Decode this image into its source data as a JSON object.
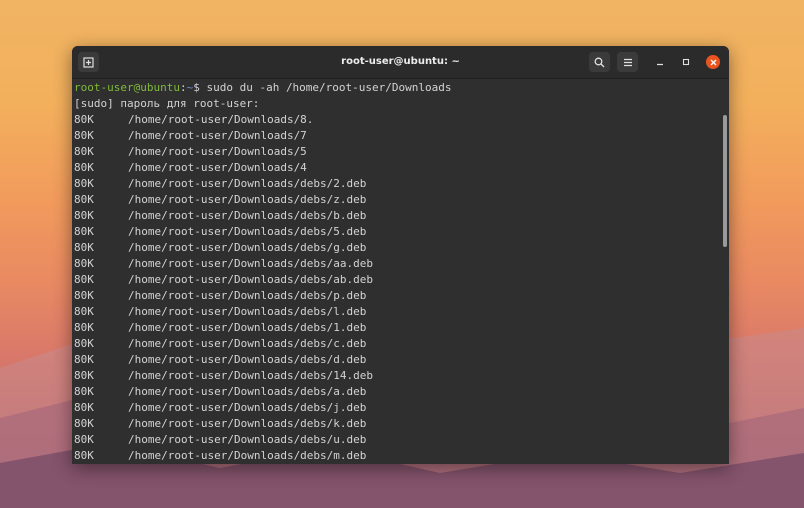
{
  "window": {
    "title": "root-user@ubuntu: ~"
  },
  "terminal": {
    "prompt_user": "root-user@ubuntu",
    "prompt_sep": ":",
    "prompt_path": "~",
    "prompt_symbol": "$",
    "command": "sudo du -ah /home/root-user/Downloads",
    "sudo_prompt": "[sudo] пароль для root-user:",
    "rows": [
      {
        "size": "80K",
        "path": "/home/root-user/Downloads/8."
      },
      {
        "size": "80K",
        "path": "/home/root-user/Downloads/7"
      },
      {
        "size": "80K",
        "path": "/home/root-user/Downloads/5"
      },
      {
        "size": "80K",
        "path": "/home/root-user/Downloads/4"
      },
      {
        "size": "80K",
        "path": "/home/root-user/Downloads/debs/2.deb"
      },
      {
        "size": "80K",
        "path": "/home/root-user/Downloads/debs/z.deb"
      },
      {
        "size": "80K",
        "path": "/home/root-user/Downloads/debs/b.deb"
      },
      {
        "size": "80K",
        "path": "/home/root-user/Downloads/debs/5.deb"
      },
      {
        "size": "80K",
        "path": "/home/root-user/Downloads/debs/g.deb"
      },
      {
        "size": "80K",
        "path": "/home/root-user/Downloads/debs/aa.deb"
      },
      {
        "size": "80K",
        "path": "/home/root-user/Downloads/debs/ab.deb"
      },
      {
        "size": "80K",
        "path": "/home/root-user/Downloads/debs/p.deb"
      },
      {
        "size": "80K",
        "path": "/home/root-user/Downloads/debs/l.deb"
      },
      {
        "size": "80K",
        "path": "/home/root-user/Downloads/debs/1.deb"
      },
      {
        "size": "80K",
        "path": "/home/root-user/Downloads/debs/c.deb"
      },
      {
        "size": "80K",
        "path": "/home/root-user/Downloads/debs/d.deb"
      },
      {
        "size": "80K",
        "path": "/home/root-user/Downloads/debs/14.deb"
      },
      {
        "size": "80K",
        "path": "/home/root-user/Downloads/debs/a.deb"
      },
      {
        "size": "80K",
        "path": "/home/root-user/Downloads/debs/j.deb"
      },
      {
        "size": "80K",
        "path": "/home/root-user/Downloads/debs/k.deb"
      },
      {
        "size": "80K",
        "path": "/home/root-user/Downloads/debs/u.deb"
      },
      {
        "size": "80K",
        "path": "/home/root-user/Downloads/debs/m.deb"
      }
    ]
  },
  "icons": {
    "new_tab": "new-tab-icon",
    "search": "search-icon",
    "menu": "hamburger-menu-icon",
    "minimize": "minimize-icon",
    "maximize": "maximize-icon",
    "close": "close-icon"
  },
  "colors": {
    "prompt_user": "#7fba3a",
    "prompt_path": "#6b8fd4",
    "close_button": "#e95420",
    "terminal_bg": "#2f2f2f"
  }
}
